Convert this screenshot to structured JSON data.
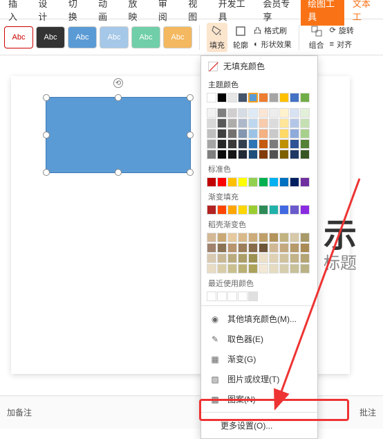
{
  "tabs": {
    "items": [
      "插入",
      "设计",
      "切换",
      "动画",
      "放映",
      "审阅",
      "视图",
      "开发工具",
      "会员专享"
    ],
    "active": "绘图工具",
    "secondary": "文本工"
  },
  "ribbon": {
    "styles": [
      "Abc",
      "Abc",
      "Abc",
      "Abc",
      "Abc",
      "Abc"
    ],
    "fill_label": "填充",
    "outline_label": "轮廓",
    "format_label": "格式刷",
    "shape_effect_label": "形状效果",
    "group_label": "组合",
    "rotate_label": "旋转",
    "align_label": "对齐"
  },
  "dropdown": {
    "no_fill": "无填充颜色",
    "theme_colors": "主题颜色",
    "standard_colors": "标准色",
    "gradient_fill": "渐变填充",
    "texture_gradient": "稻壳渐变色",
    "recent_colors": "最近使用颜色",
    "more_colors": "其他填充颜色(M)...",
    "eyedropper": "取色器(E)",
    "gradient": "渐变(G)",
    "texture": "图片或纹理(T)",
    "pattern": "图案(N)",
    "more_settings": "更多设置(O)..."
  },
  "canvas": {
    "title_placeholder": "示",
    "subtitle_placeholder": "标题"
  },
  "footer": {
    "notes": "加备注",
    "comments": "批注"
  },
  "theme_row1": [
    "#ffffff",
    "#000000",
    "#e7e6e6",
    "#44546a",
    "#5b9bd5",
    "#ed7d31",
    "#a5a5a5",
    "#ffc000",
    "#4472c4",
    "#70ad47"
  ],
  "theme_grid": [
    [
      "#f2f2f2",
      "#7f7f7f",
      "#d0cece",
      "#d6dce4",
      "#deebf6",
      "#fbe5d5",
      "#ededed",
      "#fff2cc",
      "#d9e2f3",
      "#e2efd9"
    ],
    [
      "#d8d8d8",
      "#595959",
      "#aeabab",
      "#adb9ca",
      "#bdd7ee",
      "#f7cbac",
      "#dbdbdb",
      "#fee599",
      "#b4c6e7",
      "#c5e0b3"
    ],
    [
      "#bfbfbf",
      "#3f3f3f",
      "#757070",
      "#8496b0",
      "#9cc3e5",
      "#f4b183",
      "#c9c9c9",
      "#ffd965",
      "#8eaadb",
      "#a8d08d"
    ],
    [
      "#a5a5a5",
      "#262626",
      "#3a3838",
      "#323f4f",
      "#2e75b5",
      "#c55a11",
      "#7b7b7b",
      "#bf9000",
      "#2f5496",
      "#538135"
    ],
    [
      "#7f7f7f",
      "#0c0c0c",
      "#171616",
      "#222a35",
      "#1e4e79",
      "#833c0b",
      "#525252",
      "#7f6000",
      "#1f3864",
      "#375623"
    ]
  ],
  "standard_row": [
    "#c00000",
    "#ff0000",
    "#ffc000",
    "#ffff00",
    "#92d050",
    "#00b050",
    "#00b0f0",
    "#0070c0",
    "#002060",
    "#7030a0"
  ],
  "gradient_row": [
    "#b22222",
    "#ff4500",
    "#ffa500",
    "#ffd700",
    "#9acd32",
    "#2e8b57",
    "#20b2aa",
    "#4169e1",
    "#6a5acd",
    "#8a2be2"
  ],
  "texture_grid": [
    [
      "#d4b896",
      "#c9a876",
      "#e6c99f",
      "#d9b98a",
      "#ccac7a",
      "#bfa06a",
      "#b3945c",
      "#c2b280",
      "#d6c9a8",
      "#a89968"
    ],
    [
      "#a0826d",
      "#8b7355",
      "#b8946f",
      "#9c7e5a",
      "#876b4a",
      "#6f563a",
      "#d1b894",
      "#c4a97f",
      "#b79a6a",
      "#aa8b55"
    ],
    [
      "#d8c9b0",
      "#c9b896",
      "#baab7f",
      "#ab9e68",
      "#9c9151",
      "#ede0c8",
      "#dfd1b3",
      "#d1c29e",
      "#c3b389",
      "#b5a474"
    ],
    [
      "#e8dcc4",
      "#d9cda8",
      "#cabf8e",
      "#bbb074",
      "#aca25a",
      "#f2e8d5",
      "#e4dbc1",
      "#d6cdad",
      "#c8c099",
      "#bab285"
    ]
  ],
  "recent_row": [
    "#ffffff",
    "#ffffff",
    "#ffffff",
    "#ffffff",
    "#e0e0e0"
  ]
}
